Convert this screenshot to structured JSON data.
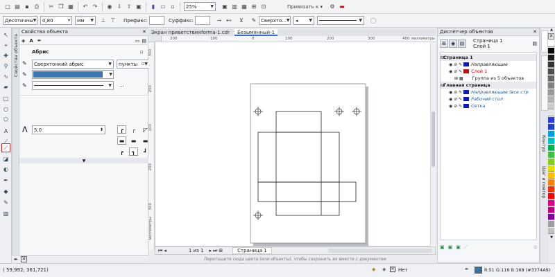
{
  "toolbar1": {
    "zoom": "25%",
    "snap_label": "Привязать к"
  },
  "toolbar2": {
    "units_mode": "Десятичны",
    "value": "0,80",
    "units": "мм",
    "prefix_label": "Префикс:",
    "suffix_label": "Суффикс:",
    "outline_style": "Сверхто..."
  },
  "properties": {
    "title": "Свойства объекта",
    "section": "Абрис",
    "outline_width": "Сверхтонкий абрис",
    "outline_units": "пункты",
    "fill_color": "#3a78b5",
    "more": "...",
    "miter": "5,0",
    "vertical_tab": "Свойства объекта"
  },
  "tabs": [
    "Экран приветствия",
    "forma-1.cdr",
    "Безымянный-1"
  ],
  "ruler": {
    "h_ticks": [
      "200",
      "100",
      "0",
      "100",
      "200",
      "300",
      "400"
    ],
    "h_unit": "миллиметры",
    "v_ticks": [
      "300",
      "200",
      "100",
      "0"
    ],
    "v_unit": "миллиметры"
  },
  "page_nav": {
    "counter": "1 из 1",
    "page_tab": "Страница 1"
  },
  "hint": "Перетащите сюда цвета (или объекты), чтобы сохранить их вместе с документом",
  "object_manager": {
    "title": "Диспетчер объектов",
    "page": "Страница 1",
    "layer": "Слой 1",
    "tree": [
      {
        "label": "Страница 1",
        "indent": 0,
        "bold": true,
        "color": "#222"
      },
      {
        "label": "Направляющие",
        "indent": 1,
        "bold": false,
        "color": "#222",
        "italic": true
      },
      {
        "label": "Слой 1",
        "indent": 1,
        "bold": false,
        "color": "#cc0000"
      },
      {
        "label": "Группа из 5 объектов",
        "indent": 2,
        "bold": false,
        "color": "#222"
      },
      {
        "label": "Главная страница",
        "indent": 0,
        "bold": true,
        "color": "#222"
      },
      {
        "label": "Направляющие (все стр",
        "indent": 1,
        "bold": false,
        "color": "#1a55b0",
        "italic": true
      },
      {
        "label": "Рабочий стол",
        "indent": 1,
        "bold": false,
        "color": "#1a55b0",
        "italic": true
      },
      {
        "label": "Сетка",
        "indent": 1,
        "bold": false,
        "color": "#1a55b0",
        "italic": true
      }
    ],
    "side_tabs": [
      "Контур",
      "Шаг и повтор"
    ]
  },
  "status": {
    "coords": "( 59,992; 361,721)",
    "fill": "Нет",
    "color_info": "R:51 G:116 B:168 (#3374A9)",
    "color": "#3374a9"
  },
  "callout": "1",
  "palette": [
    "#ffffff",
    "#000000",
    "#1a1a1a",
    "#333333",
    "#4d4d4d",
    "#666666",
    "#808080",
    "#999999",
    "#b3b3b3",
    "#cccccc",
    "#e6e6e6",
    "#2b3bdc",
    "#1e40c8",
    "#00a0e0",
    "#00c0c0",
    "#00b050",
    "#40c040",
    "#80d020",
    "#e0e000",
    "#ffc000",
    "#ff8000",
    "#ff3000",
    "#ff0000",
    "#e0007f",
    "#c00080",
    "#8000a0",
    "#a0a0a0",
    "#c0c0c0"
  ]
}
